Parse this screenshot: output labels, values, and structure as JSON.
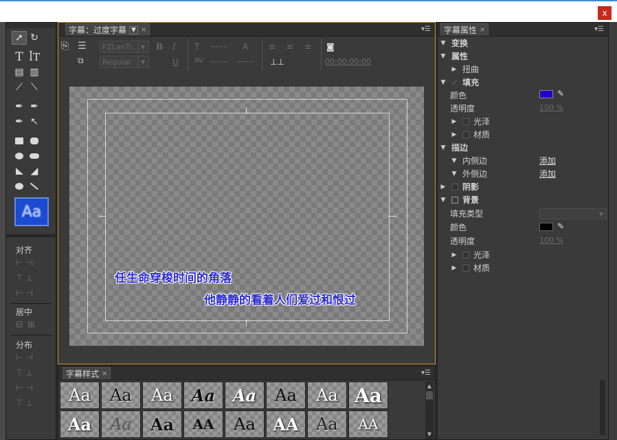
{
  "window": {
    "close_label": "x"
  },
  "tools_panel": {
    "preview_label": "Aa"
  },
  "align_panel": {
    "align_label": "对齐",
    "center_label": "居中",
    "distribute_label": "分布"
  },
  "title_panel": {
    "tab_label": "字幕：过度字幕",
    "font_family": "FZLanTi...",
    "font_style": "Regular",
    "timecode": "00:00:00:00"
  },
  "subtitles": {
    "line1": "任生命穿梭时间的角落",
    "line2": "他静静的看着人们爱过和恨过",
    "color": "#2a2ad0"
  },
  "styles_panel": {
    "tab_label": "字幕样式",
    "thumbs_row1": [
      "Aa",
      "Aa",
      "Aa",
      "Aa",
      "Aa",
      "Aa",
      "Aa",
      "Aa"
    ],
    "thumbs_row2": [
      "Aa",
      "Aa",
      "Aa",
      "AA",
      "Aa",
      "AA",
      "Aa",
      "AA"
    ]
  },
  "properties_panel": {
    "tab_label": "字幕属性",
    "transform": "变换",
    "properties": "属性",
    "distort": "扭曲",
    "fill": "填充",
    "fill_color_label": "颜色",
    "fill_color": "#2200cc",
    "fill_opacity_label": "透明度",
    "fill_opacity": "100 %",
    "sheen": "光泽",
    "texture": "材质",
    "strokes": "描边",
    "inner_stroke": "内侧边",
    "outer_stroke": "外侧边",
    "add_label": "添加",
    "shadow": "阴影",
    "background": "背景",
    "fill_type_label": "填充类型",
    "bg_color_label": "颜色",
    "bg_color": "#000000",
    "bg_opacity_label": "透明度",
    "bg_opacity": "100 %",
    "bg_sheen": "光泽",
    "bg_texture": "材质"
  }
}
